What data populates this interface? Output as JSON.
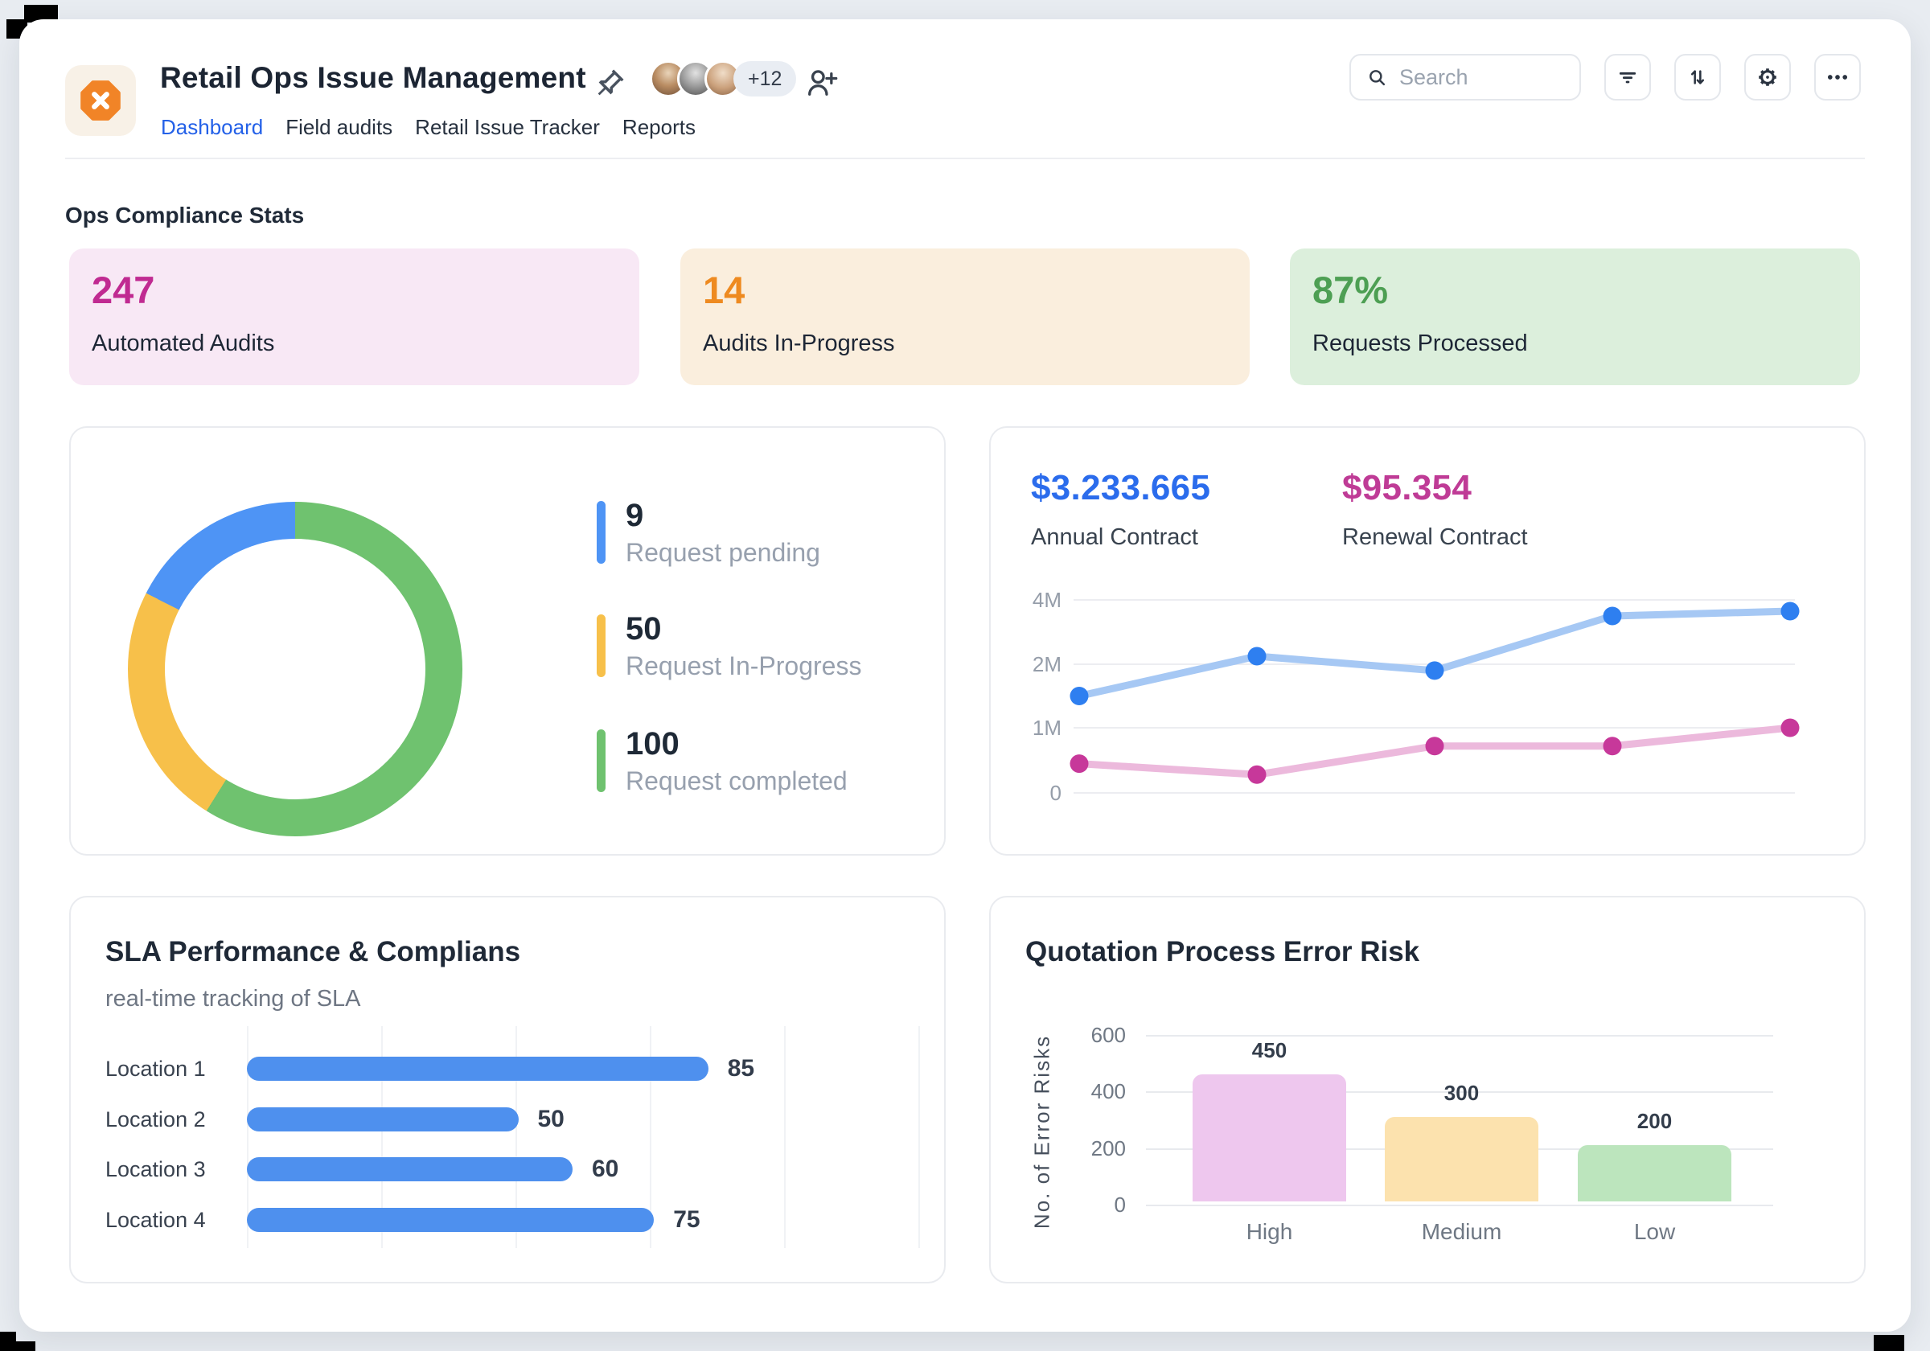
{
  "header": {
    "title": "Retail Ops Issue Management",
    "avatar_overflow_label": "+12",
    "tabs": [
      {
        "label": "Dashboard",
        "active": true
      },
      {
        "label": "Field audits",
        "active": false
      },
      {
        "label": "Retail Issue Tracker",
        "active": false
      },
      {
        "label": "Reports",
        "active": false
      }
    ],
    "search": {
      "placeholder": "Search"
    },
    "toolbar_icons": [
      "filter-icon",
      "sort-icon",
      "settings-icon",
      "more-icon"
    ],
    "logo_icon": "octagon-x-icon",
    "logo_color": "#f18427"
  },
  "stats": {
    "section_title": "Ops Compliance Stats",
    "cards": [
      {
        "value": "247",
        "label": "Automated Audits",
        "bg": "#f8e8f5",
        "value_color": "#c02a91"
      },
      {
        "value": "14",
        "label": "Audits In-Progress",
        "bg": "#faeedd",
        "value_color": "#ee8a20"
      },
      {
        "value": "87%",
        "label": "Requests Processed",
        "bg": "#dcefdc",
        "value_color": "#4d9f53"
      }
    ]
  },
  "contracts": {
    "annual": {
      "value": "$3.233.665",
      "label": "Annual Contract",
      "color": "#2b6cec"
    },
    "renewal": {
      "value": "$95.354",
      "label": "Renewal Contract",
      "color": "#bf3b96"
    }
  },
  "sla_card": {
    "title": "SLA Performance & Complians",
    "subtitle": "real-time tracking of SLA"
  },
  "quotation_card": {
    "title": "Quotation Process Error Risk"
  },
  "chart_data": [
    {
      "id": "requests_donut",
      "type": "pie",
      "labels": [
        "Request pending",
        "Request In-Progress",
        "Request completed"
      ],
      "values": [
        9,
        50,
        100
      ],
      "colors": [
        "#4e94f5",
        "#f7c04a",
        "#6fc26f"
      ],
      "segments_deg": [
        [
          297,
          360
        ],
        [
          212,
          297
        ],
        [
          0,
          212
        ]
      ],
      "legend_position": "right",
      "donut": true
    },
    {
      "id": "contracts_line",
      "type": "line",
      "x": [
        1,
        2,
        3,
        4,
        5
      ],
      "series": [
        {
          "name": "Annual Contract",
          "values_m": [
            1.5,
            2.25,
            1.9,
            3.5,
            3.65
          ],
          "line_color": "#a6c8f4",
          "dot_color": "#2e7ff0"
        },
        {
          "name": "Renewal Contract",
          "values_m": [
            0.45,
            0.28,
            0.72,
            0.72,
            1.0
          ],
          "line_color": "#ecb9dc",
          "dot_color": "#c7389a"
        }
      ],
      "y_ticks": [
        "0",
        "1M",
        "2M",
        "4M"
      ],
      "y_tick_values_m": [
        0,
        1,
        2,
        4
      ],
      "grid": "horizontal",
      "ylim_m": [
        0,
        4.4
      ]
    },
    {
      "id": "sla_bars",
      "type": "bar",
      "orientation": "horizontal",
      "categories": [
        "Location 1",
        "Location 2",
        "Location 3",
        "Location 4"
      ],
      "values": [
        85,
        50,
        60,
        75
      ],
      "xlim": [
        0,
        100
      ],
      "bar_color": "#4e90ee",
      "grid": "vertical"
    },
    {
      "id": "error_risk_bars",
      "type": "bar",
      "orientation": "vertical",
      "categories": [
        "High",
        "Medium",
        "Low"
      ],
      "values": [
        450,
        300,
        200
      ],
      "colors": [
        "#eec7ee",
        "#fce2ae",
        "#bce5bd"
      ],
      "y_ticks": [
        0,
        200,
        400,
        600
      ],
      "ylim": [
        0,
        600
      ],
      "ylabel": "No. of Error Risks",
      "grid": "horizontal"
    }
  ]
}
